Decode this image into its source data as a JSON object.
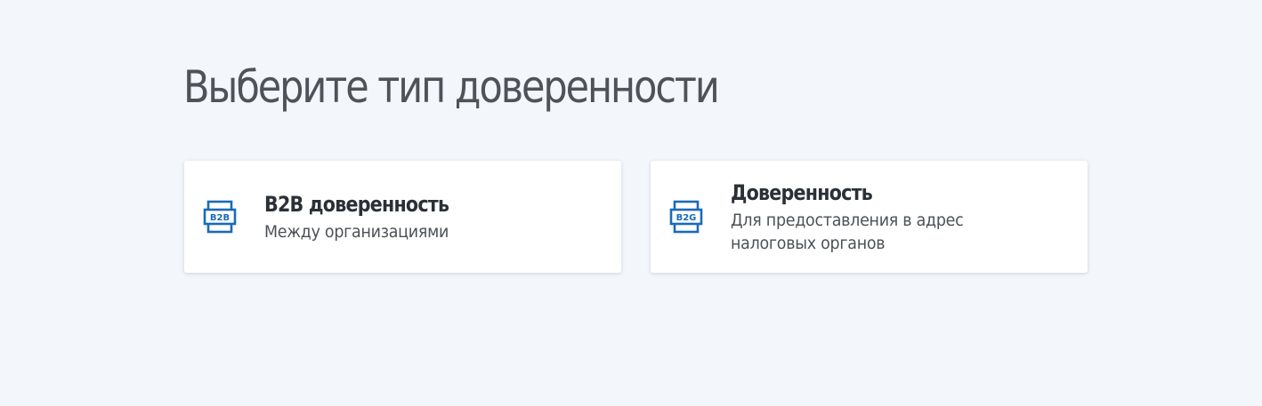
{
  "page_title": "Выберите тип доверенности",
  "accent_color": "#1a6bb8",
  "cards": [
    {
      "icon": "b2b-icon",
      "icon_label": "B2B",
      "title": "B2B доверенность",
      "description": [
        "Между организациями"
      ]
    },
    {
      "icon": "b2g-icon",
      "icon_label": "B2G",
      "title": "Доверенность",
      "description": [
        "Для предоставления в адрес",
        "налоговых органов"
      ]
    }
  ]
}
